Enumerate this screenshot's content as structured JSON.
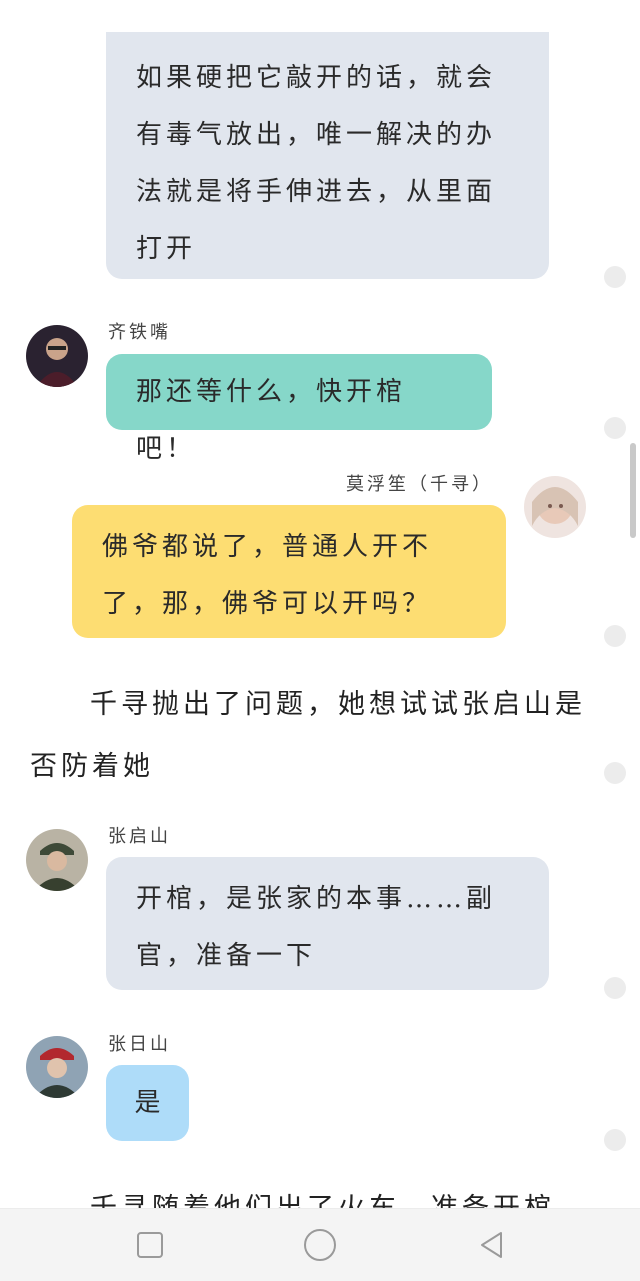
{
  "messages": [
    {
      "text": "如果硬把它敲开的话，就会有毒气放出，唯一解决的办法就是将手伸进去，从里面打开"
    },
    {
      "name": "齐铁嘴",
      "text": "那还等什么，快开棺吧！"
    },
    {
      "name": "莫浮笙（千寻）",
      "text": "佛爷都说了，普通人开不了，那，佛爷可以开吗？"
    },
    {
      "name": "张启山",
      "text": "开棺，是张家的本事……副官，准备一下"
    },
    {
      "name": "张日山",
      "text": "是"
    }
  ],
  "narration": [
    "千寻抛出了问题，她想试试张启山是否防着她",
    "千寻随着他们出了火车，准备开棺"
  ],
  "colors": {
    "grey_bubble": "#e1e6ee",
    "teal_bubble": "#86d7c9",
    "yellow_bubble": "#fddd72",
    "blue_bubble": "#aedcf9"
  },
  "nav": {
    "icons": [
      "square-recents-icon",
      "circle-home-icon",
      "triangle-back-icon"
    ]
  }
}
